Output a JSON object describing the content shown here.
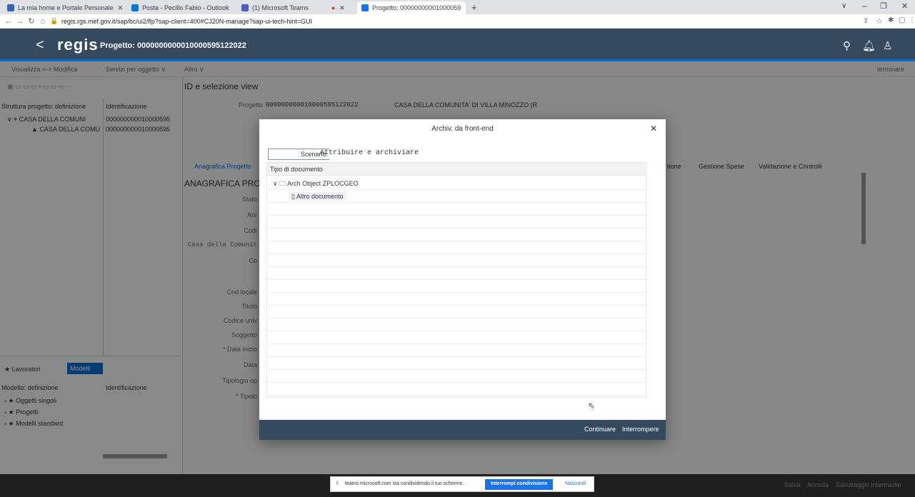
{
  "browser": {
    "tabs": [
      {
        "label": "La mia home e Portale Personale",
        "color": "#3165b5"
      },
      {
        "label": "Posta - Pecillo Fabio - Outlook",
        "color": "#0078d4"
      },
      {
        "label": "(1) Microsoft Teams",
        "color": "#5059c9"
      },
      {
        "label": "Progetto: 00000000001000059",
        "color": "#1a73e8"
      }
    ],
    "url": "regis.rgs.mef.gov.it/sap/bc/ui2/flp?sap-client=400#CJ20N-manage?sap-ui-tech-hint=GUI"
  },
  "shell": {
    "logo": "regis",
    "title": "Progetto: 0000000000010000595122022"
  },
  "menu": {
    "items": [
      "Visualizza <-> Modifica",
      "Servizi per oggetto ∨",
      "Altro ∨"
    ],
    "right": "terminare"
  },
  "left_panel": {
    "col1": "Struttura progetto: definizione",
    "col2": "Identificazione",
    "rows": [
      {
        "name": "CASA DELLA COMUNI",
        "id": "000000000010000595"
      },
      {
        "name": "CASA DELLA COMU",
        "id": "000000000010000595"
      }
    ],
    "buttons": [
      "Lavoratori",
      "Modelli"
    ],
    "col3": "Modello: definizione",
    "col4": "Identificazione",
    "models": [
      "Oggetti singoli",
      "Progetti",
      "Modelli standard"
    ]
  },
  "main": {
    "section": "ID e selezione view",
    "project_label": "Progetto",
    "project_id": "000000000010000595122022",
    "project_name": "CASA DELLA COMUNITA' DI VILLA MINOZZO (R",
    "tabs": [
      "Anagrafica Progetto",
      "tione",
      "Gestione Spese",
      "Validazione e Controlli"
    ],
    "heading": "ANAGRAFICA PROG",
    "labels": [
      "Stato",
      "Anr",
      "Codi",
      "Casa della Comunit",
      "Co",
      "Cod locale",
      "Titolo",
      "Codice univ",
      "Soggetto",
      "* Data inizio",
      "Data",
      "Tipologia op",
      "* Tipolo"
    ]
  },
  "dialog": {
    "title": "Archiv. da front-end",
    "scenario_label": "Scenario:",
    "scenario_value": "Attribuire e archiviare",
    "column": "Tipo di documento",
    "tree": [
      {
        "label": "Arch Object ZPLOCGEO",
        "level": 0
      },
      {
        "label": "Altro documento",
        "level": 1
      }
    ],
    "buttons": {
      "continue": "Continuare",
      "cancel": "Interrompere"
    }
  },
  "share": {
    "text": "teams.microsoft.com sta condividendo il tuo schermo.",
    "stop": "Interrompi condivisione",
    "hide": "Nascondi"
  },
  "footer": {
    "buttons": [
      "Salva",
      "Annulla",
      "Salvataggio intermedio"
    ]
  }
}
